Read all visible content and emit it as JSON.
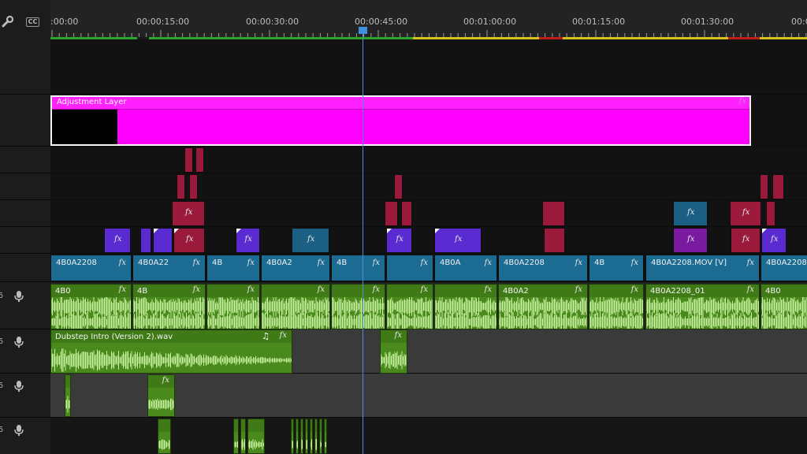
{
  "header": {
    "wrench_icon": "wrench-icon",
    "cc_label": "CC",
    "audio_label": "5",
    "mic_icon": "microphone-icon"
  },
  "ruler": {
    "timecodes": [
      ":00:00",
      "00:00:15:00",
      "00:00:30:00",
      "00:00:45:00",
      "00:01:00:00",
      "00:01:15:00",
      "00:01:30:00",
      "00:0"
    ]
  },
  "adjustment_layer": {
    "label": "Adjustment Layer",
    "fx": "fx"
  },
  "v1_clips": [
    {
      "name": "4B0A2208",
      "fx": "fx"
    },
    {
      "name": "4B0A22",
      "fx": "fx"
    },
    {
      "name": "4B",
      "fx": "fx"
    },
    {
      "name": "4B0A2",
      "fx": "fx"
    },
    {
      "name": "4B",
      "fx": "fx"
    },
    {
      "name": "",
      "fx": "fx"
    },
    {
      "name": "4B0A",
      "fx": "fx"
    },
    {
      "name": "4B0A2208",
      "fx": "fx"
    },
    {
      "name": "4B",
      "fx": "fx"
    },
    {
      "name": "4B0A2208.MOV [V]",
      "fx": "fx"
    },
    {
      "name": "4B0A2208",
      "fx": ""
    }
  ],
  "a1_clips": [
    {
      "name": "4B0",
      "fx": "fx"
    },
    {
      "name": "4B",
      "fx": "fx"
    },
    {
      "name": "",
      "fx": "fx"
    },
    {
      "name": "",
      "fx": "fx"
    },
    {
      "name": "",
      "fx": "fx"
    },
    {
      "name": "",
      "fx": "fx"
    },
    {
      "name": "",
      "fx": "fx"
    },
    {
      "name": "4B0A2",
      "fx": "fx"
    },
    {
      "name": "",
      "fx": "fx"
    },
    {
      "name": "4B0A2208_01",
      "fx": "fx"
    },
    {
      "name": "4B0",
      "fx": ""
    }
  ],
  "a2_clips": [
    {
      "name": "Dubstep Intro (Version 2).wav",
      "fx": "fx",
      "note": "♫"
    },
    {
      "name": "",
      "fx": "fx",
      "note": ""
    }
  ],
  "a3_clips": [
    {
      "name": "",
      "fx": ""
    },
    {
      "name": "",
      "fx": "fx"
    }
  ],
  "colors": {
    "magenta": "#ff00ff",
    "video_blue": "#1b6b93",
    "fx_purple": "#5a2bd0",
    "fx_red": "#9b1a3c",
    "audio_green": "#4a8a1c",
    "playhead": "#4b8fd8"
  }
}
